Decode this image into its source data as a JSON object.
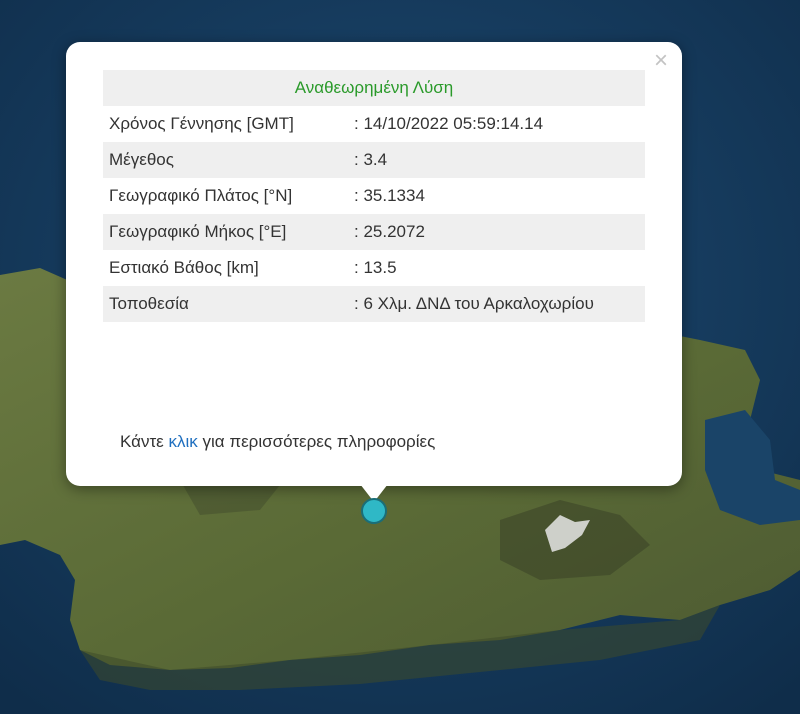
{
  "popup": {
    "title": "Αναθεωρημένη Λύση",
    "close_label": "×",
    "rows": [
      {
        "label": "Χρόνος Γέννησης [GMT]",
        "value": ": 14/10/2022 05:59:14.14"
      },
      {
        "label": "Μέγεθος",
        "value": ": 3.4"
      },
      {
        "label": "Γεωγραφικό Πλάτος [°N]",
        "value": ": 35.1334"
      },
      {
        "label": "Γεωγραφικό Μήκος [°E]",
        "value": ": 25.2072"
      },
      {
        "label": "Εστιακό Βάθος [km]",
        "value": ": 13.5"
      },
      {
        "label": "Τοποθεσία",
        "value": ": 6 Χλμ. ΔΝΔ του Αρκαλοχωρίου"
      }
    ],
    "more_prefix": "Κάντε",
    "more_link": "κλικ",
    "more_suffix": "για περισσότερες πληροφορίες"
  },
  "colors": {
    "title_green": "#2a9a2a",
    "link_blue": "#1f6fbf",
    "marker": "#2fb8c6",
    "sea": "#163a5c",
    "land": "#5c6b3a"
  }
}
